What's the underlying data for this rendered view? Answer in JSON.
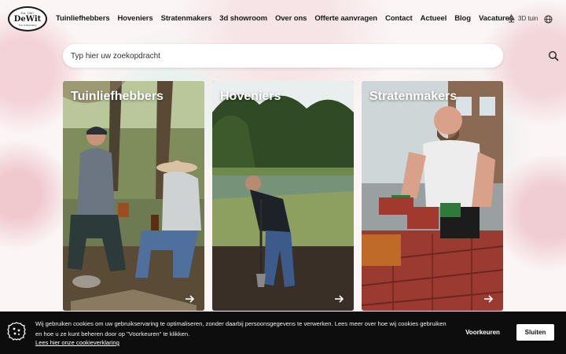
{
  "brand": {
    "logo_since": "Est. 1967",
    "logo_name": "DeWit",
    "logo_tagline": "Tuin & Bestrating"
  },
  "nav": {
    "items": [
      {
        "label": "Tuinliefhebbers"
      },
      {
        "label": "Hoveniers"
      },
      {
        "label": "Stratenmakers"
      },
      {
        "label": "3d showroom"
      },
      {
        "label": "Over ons"
      },
      {
        "label": "Offerte aanvragen"
      },
      {
        "label": "Contact"
      },
      {
        "label": "Actueel"
      },
      {
        "label": "Blog"
      },
      {
        "label": "Vacatures"
      }
    ],
    "tuin3d_label": "3D tuin",
    "language_icon": "globe-icon"
  },
  "search": {
    "placeholder": "Typ hier uw zoekopdracht",
    "value": "",
    "icon": "search-icon"
  },
  "cards": [
    {
      "title": "Tuinliefhebbers",
      "icon": "arrow-right-icon"
    },
    {
      "title": "Hoveniers",
      "icon": "arrow-right-icon"
    },
    {
      "title": "Stratenmakers",
      "icon": "arrow-right-icon"
    }
  ],
  "cookie": {
    "text": "Wij gebruiken cookies om uw gebruikservaring te optimaliseren, zonder daarbij persoonsgegevens te verwerken. Lees meer over hoe wij cookies gebruiken en hoe u ze kunt beheren door op \"Voorkeuren\" te klikken.",
    "link": "Lees hier onze cookieverklaring",
    "preferences_label": "Voorkeuren",
    "close_label": "Sluiten",
    "icon": "cookie-icon"
  },
  "colors": {
    "background": "#fbf5f5",
    "cookie_bar": "#0d0d0d",
    "text": "#1a1a1a"
  }
}
